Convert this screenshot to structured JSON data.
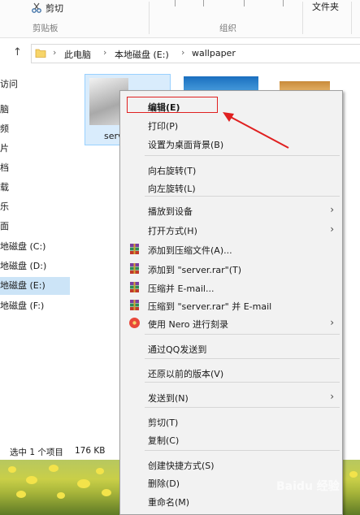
{
  "ribbon": {
    "cut_label": "剪切",
    "clipboard_group": "剪贴板",
    "organize_group": "组织",
    "folder_label": "文件夹"
  },
  "address": {
    "crumbs": [
      "此电脑",
      "本地磁盘 (E:)",
      "wallpaper"
    ]
  },
  "nav": {
    "items": [
      "访问",
      "脑",
      "频",
      "片",
      "档",
      "载",
      "乐",
      "面",
      "地磁盘 (C:)",
      "地磁盘 (D:)",
      "地磁盘 (E:)",
      "地磁盘 (F:)"
    ]
  },
  "files": {
    "first_label": "serv"
  },
  "status": {
    "selected": "选中 1 个项目",
    "size": "176 KB"
  },
  "menu": {
    "items": [
      {
        "label": "编辑(E)",
        "arrow": ""
      },
      {
        "label": "打印(P)",
        "arrow": ""
      },
      {
        "label": "设置为桌面背景(B)",
        "arrow": ""
      },
      {
        "label": "向右旋转(T)",
        "arrow": ""
      },
      {
        "label": "向左旋转(L)",
        "arrow": ""
      },
      {
        "label": "播放到设备",
        "arrow": "›"
      },
      {
        "label": "打开方式(H)",
        "arrow": "›"
      },
      {
        "label": "添加到压缩文件(A)...",
        "arrow": ""
      },
      {
        "label": "添加到 \"server.rar\"(T)",
        "arrow": ""
      },
      {
        "label": "压缩并 E-mail...",
        "arrow": ""
      },
      {
        "label": "压缩到 \"server.rar\" 并 E-mail",
        "arrow": ""
      },
      {
        "label": "使用 Nero 进行刻录",
        "arrow": "›"
      },
      {
        "label": "通过QQ发送到",
        "arrow": ""
      },
      {
        "label": "还原以前的版本(V)",
        "arrow": ""
      },
      {
        "label": "发送到(N)",
        "arrow": "›"
      },
      {
        "label": "剪切(T)",
        "arrow": ""
      },
      {
        "label": "复制(C)",
        "arrow": ""
      },
      {
        "label": "创建快捷方式(S)",
        "arrow": ""
      },
      {
        "label": "删除(D)",
        "arrow": ""
      },
      {
        "label": "重命名(M)",
        "arrow": ""
      }
    ]
  },
  "watermark": "Baidu 经验",
  "colors": {
    "highlight_red": "#e02020",
    "selection_blue": "#cce4f7"
  }
}
